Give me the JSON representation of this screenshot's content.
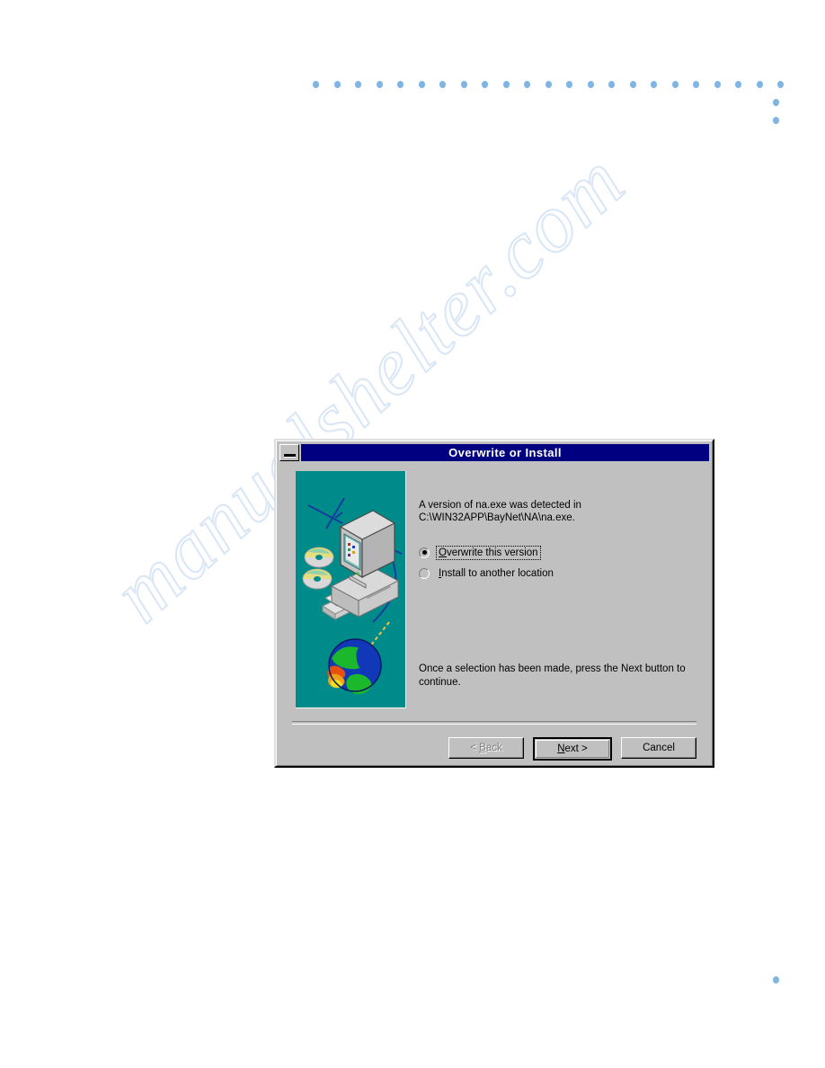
{
  "page": {
    "background_color": "#ffffff",
    "watermark_text": "manualshelter.com"
  },
  "decoration": {
    "dot_color": "#7fb5e6",
    "row_dot_count": 23,
    "column_dot_count": 2,
    "corner_dot_present": true
  },
  "dialog": {
    "title": "Overwrite or Install",
    "title_bar_color": "#000080",
    "face_color": "#c0c0c0",
    "minimize_icon": "minimize-icon",
    "illustration": {
      "background_color": "#008b8b",
      "description": "computer-cds-floppy-globe-illustration"
    },
    "message_lines": [
      "A version of na.exe was detected in",
      "C:\\WIN32APP\\BayNet\\NA\\na.exe."
    ],
    "options": [
      {
        "accel": "O",
        "rest": "verwrite this version",
        "selected": true,
        "focused": true
      },
      {
        "accel": "I",
        "rest": "nstall to another location",
        "selected": false,
        "focused": false
      }
    ],
    "instruction": "Once a selection has been made, press the Next button to continue.",
    "buttons": [
      {
        "accel": "B",
        "prefix": "< ",
        "rest": "ack",
        "suffix": "",
        "disabled": true,
        "is_default": false,
        "name": "back-button"
      },
      {
        "accel": "N",
        "prefix": "",
        "rest": "ext",
        "suffix": " >",
        "disabled": false,
        "is_default": true,
        "name": "next-button"
      },
      {
        "accel": "",
        "prefix": "",
        "rest": "Cancel",
        "suffix": "",
        "disabled": false,
        "is_default": false,
        "name": "cancel-button"
      }
    ]
  }
}
